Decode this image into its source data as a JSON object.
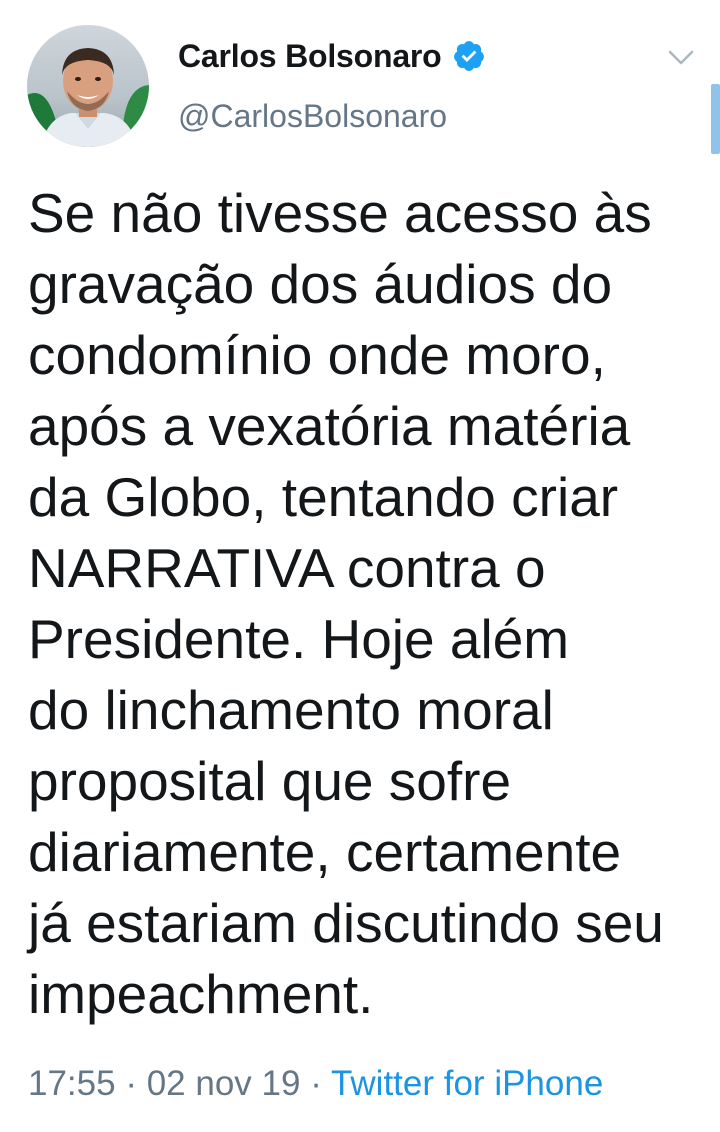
{
  "author": {
    "name": "Carlos Bolsonaro",
    "handle": "@CarlosBolsonaro",
    "verified": true,
    "avatar": "profile-photo"
  },
  "tweet": {
    "lines": [
      "Se não tivesse acesso às",
      "gravação dos áudios do",
      "condomínio onde moro,",
      "após a vexatória matéria",
      "da Globo, tentando criar",
      "NARRATIVA contra o",
      "Presidente. Hoje além",
      "do linchamento moral",
      "proposital que sofre",
      "diariamente, certamente",
      "já estariam discutindo seu",
      "impeachment."
    ]
  },
  "meta": {
    "time": "17:55",
    "separator": "·",
    "date": "02 nov 19",
    "source": "Twitter for iPhone"
  },
  "icons": {
    "verified": "verified-badge-icon",
    "menu": "chevron-down-icon"
  },
  "colors": {
    "text": "#14171a",
    "secondary": "#657786",
    "link": "#1b95e0",
    "verified": "#1da1f2"
  }
}
